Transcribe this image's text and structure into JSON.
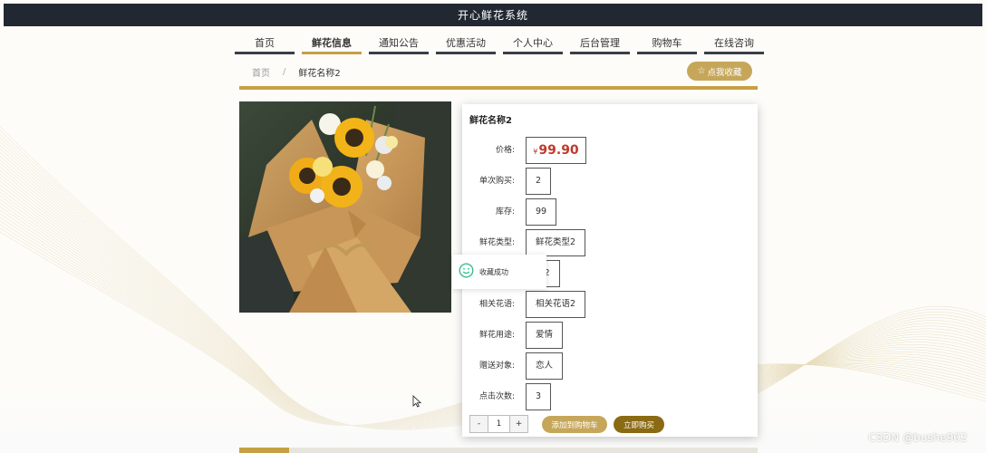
{
  "app": {
    "title": "开心鲜花系统"
  },
  "nav": {
    "items": [
      {
        "label": "首页"
      },
      {
        "label": "鲜花信息",
        "active": true
      },
      {
        "label": "通知公告"
      },
      {
        "label": "优惠活动"
      },
      {
        "label": "个人中心"
      },
      {
        "label": "后台管理"
      },
      {
        "label": "购物车"
      },
      {
        "label": "在线咨询"
      }
    ]
  },
  "breadcrumb": {
    "home": "首页",
    "separator": "/",
    "current": "鲜花名称2"
  },
  "favorite_button": {
    "label": "点我收藏",
    "icon": "star-outline-icon"
  },
  "product": {
    "name": "鲜花名称2",
    "price": {
      "label": "价格:",
      "currency": "¥",
      "value": "99.90"
    },
    "fields": [
      {
        "label": "单次购买:",
        "value": "2"
      },
      {
        "label": "库存:",
        "value": "99"
      },
      {
        "label": "鲜花类型:",
        "value": "鲜花类型2"
      },
      {
        "label": "",
        "value": "料2"
      },
      {
        "label": "相关花语:",
        "value": "相关花语2"
      },
      {
        "label": "鲜花用途:",
        "value": "爱情"
      },
      {
        "label": "赠送对象:",
        "value": "恋人"
      },
      {
        "label": "点击次数:",
        "value": "3"
      }
    ]
  },
  "quantity": {
    "minus": "-",
    "value": "1",
    "plus": "+"
  },
  "actions": {
    "add_to_cart": "添加到购物车",
    "buy_now": "立即购买"
  },
  "toast": {
    "message": "收藏成功",
    "icon": "smile-success-icon"
  },
  "watermark": "CSDN @bushe902",
  "colors": {
    "topbar": "#222831",
    "accent_gold": "#c6a044",
    "button_gold": "#c6a75a",
    "buy_brown": "#8a6a12",
    "price_red": "#c0392b",
    "toast_green": "#3bbf8f"
  }
}
